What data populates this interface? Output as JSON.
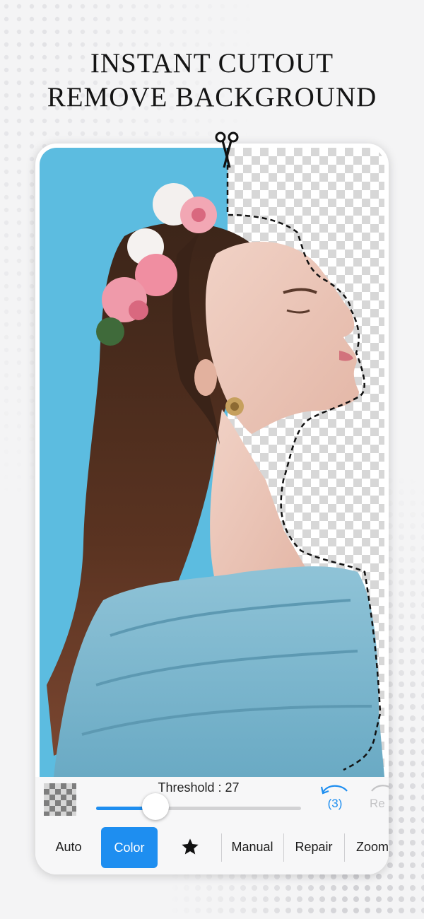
{
  "headline": {
    "line1": "INSTANT CUTOUT",
    "line2": "REMOVE BACKGROUND"
  },
  "editor": {
    "threshold_label": "Threshold : 27",
    "threshold_value": 27,
    "slider_fraction": 0.29,
    "undo_count": "(3)",
    "redo_label": "Re",
    "tools": [
      {
        "label": "Auto"
      },
      {
        "label": "Color",
        "active": true
      },
      {
        "label": "",
        "icon": "star-icon"
      },
      {
        "label": "Manual"
      },
      {
        "label": "Repair"
      },
      {
        "label": "Zoom"
      }
    ],
    "accent_color": "#1e8ef0"
  },
  "photo": {
    "background_color": "#5cbce0",
    "subject": "woman-in-profile-with-flower-crown",
    "transparent_pattern": "checkerboard"
  },
  "icons": [
    "scissors-icon",
    "transparent-background-icon",
    "undo-icon",
    "redo-icon",
    "star-icon"
  ]
}
